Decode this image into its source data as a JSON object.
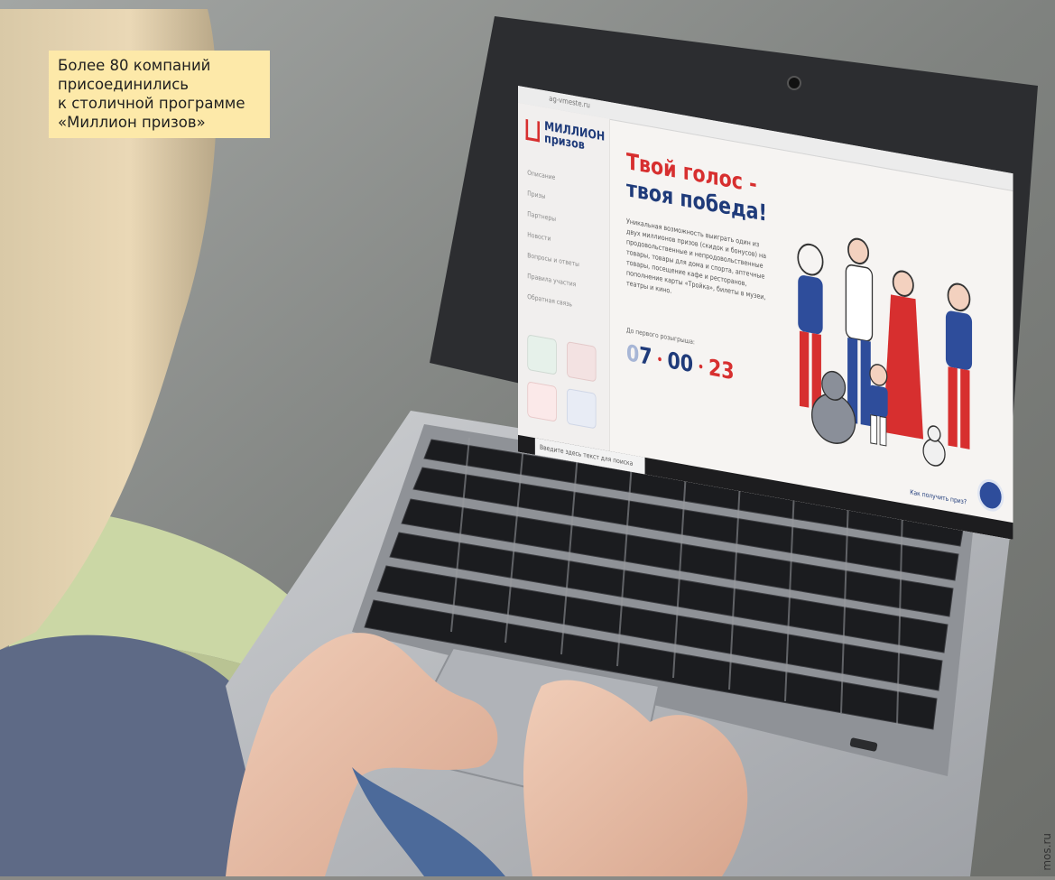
{
  "caption": {
    "lines": [
      "Более 80 компаний",
      "присоединились",
      "к столичной программе",
      "«Миллион призов»"
    ]
  },
  "credit": "mos.ru",
  "website": {
    "address": "ag-vmeste.ru",
    "brand": [
      "МИЛЛИОН",
      "призов"
    ],
    "nav": [
      "Описание",
      "Призы",
      "Партнеры",
      "Новости",
      "Вопросы и ответы",
      "Правила участия",
      "Обратная связь"
    ],
    "hero_title_line1": "Твой голос -",
    "hero_title_line2": "твоя победа!",
    "hero_text": "Уникальная возможность выиграть один из двух миллионов призов (скидок и бонусов) на продовольственные и непродовольственные товары, товары для дома и спорта, аптечные товары, посещение кафе и ресторанов, пополнение карты «Тройка», билеты в музеи, театры и кино.",
    "countdown_label": "До первого розыгрыша:",
    "countdown_days_zero": "0",
    "countdown_days": "7",
    "countdown_hours": "00",
    "countdown_minutes": "23",
    "taskbar_search": "Введите здесь текст для поиска",
    "footer_link": "Как получить приз?"
  },
  "colors": {
    "caption_bg": "#fde9a9",
    "brand_red": "#d72f2f",
    "brand_blue": "#1f3b7a"
  }
}
